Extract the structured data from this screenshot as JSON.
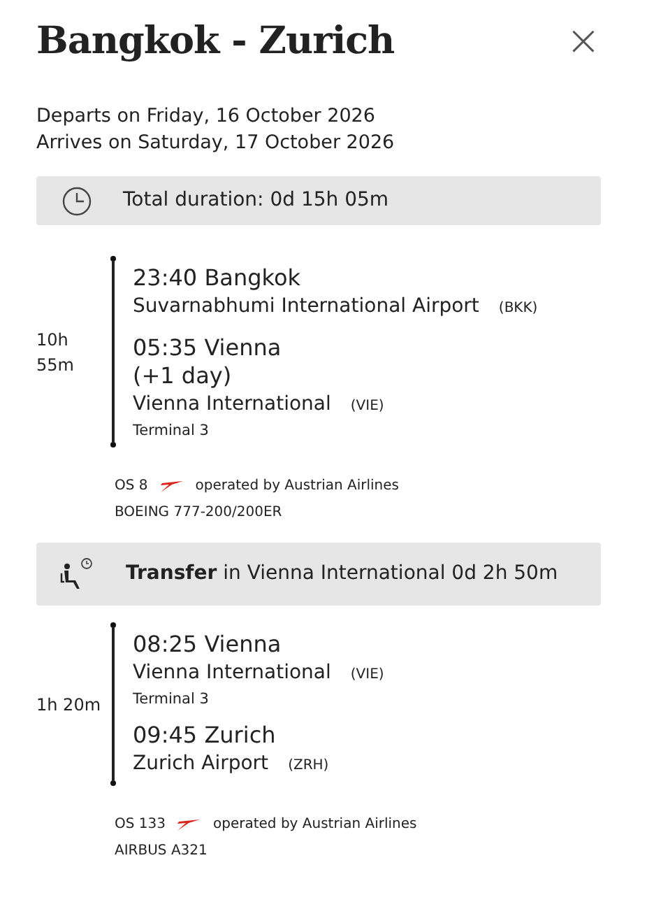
{
  "title": "Bangkok - Zurich",
  "close": "×",
  "departs": "Departs on Friday, 16 October 2026",
  "arrives": "Arrives on Saturday, 17 October 2026",
  "total_duration": "Total duration: 0d 15h 05m",
  "segments": [
    {
      "kind": "flight",
      "duration": "10h 55m",
      "stops": [
        {
          "time_city": "23:40 Bangkok",
          "airport": "Suvarnabhumi International Airport",
          "code": "(BKK)"
        },
        {
          "time_city": "05:35 Vienna",
          "day_offset": "(+1 day)",
          "airport": "Vienna International",
          "code": "(VIE)",
          "terminal": "Terminal 3"
        }
      ],
      "flight_number": "OS 8",
      "operator": "operated by Austrian Airlines",
      "aircraft": "BOEING 777-200/200ER"
    },
    {
      "kind": "transfer",
      "text": "**Transfer** in Vienna International 0d 2h 50m"
    },
    {
      "kind": "flight",
      "duration": "1h 20m",
      "stops": [
        {
          "time_city": "08:25 Vienna",
          "airport": "Vienna International",
          "code": "(VIE)",
          "terminal": "Terminal 3"
        },
        {
          "time_city": "09:45 Zurich",
          "airport": "Zurich Airport",
          "code": "(ZRH)"
        }
      ],
      "flight_number": "OS 133",
      "operator": "operated by Austrian Airlines",
      "aircraft": "AIRBUS A321"
    }
  ]
}
